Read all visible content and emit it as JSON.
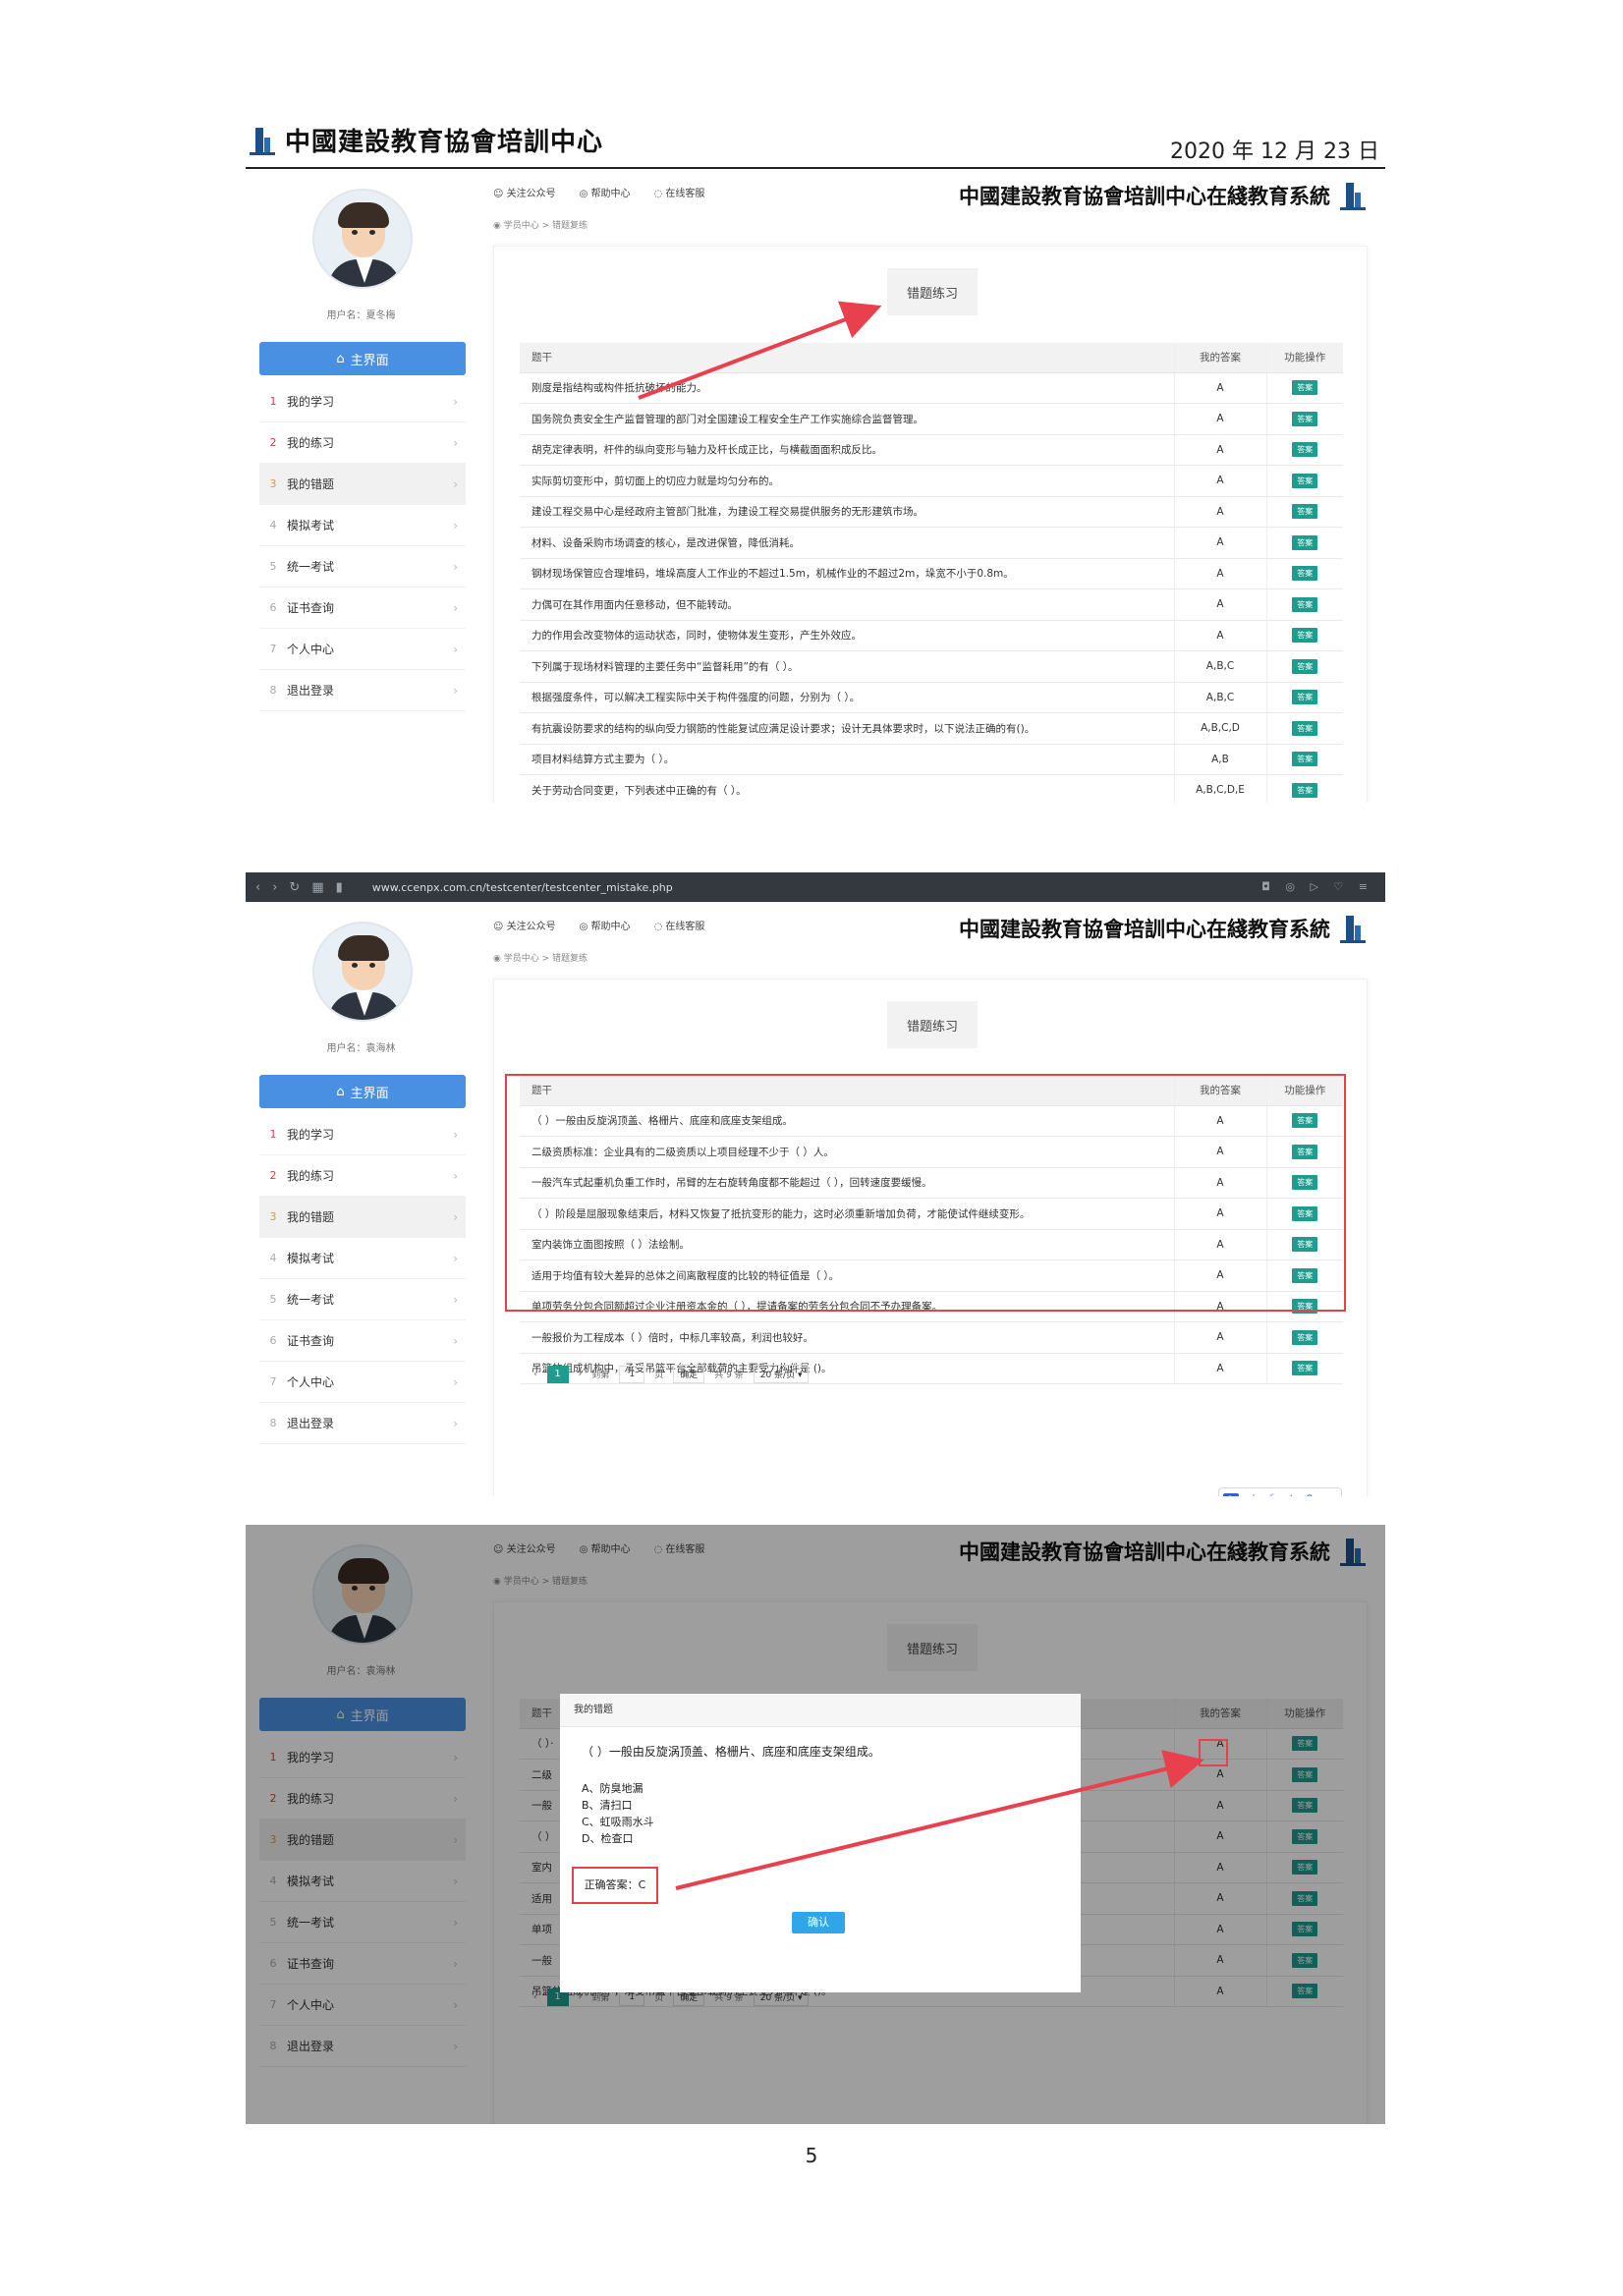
{
  "doc": {
    "org_title": "中國建設教育協會培訓中心",
    "date": "2020 年 12 月 23 日",
    "page_number": "5"
  },
  "site": {
    "brand": "中國建設教育協會培訓中心在綫教育系統",
    "top_links": [
      "关注公众号",
      "帮助中心",
      "在线客服"
    ],
    "breadcrumb": "学员中心 > 错题复练",
    "main_button": "主界面",
    "panel_title": "错题练习",
    "columns": [
      "题干",
      "我的答案",
      "功能操作"
    ],
    "answer_btn": "答案",
    "menu": [
      {
        "num": "1",
        "label": "我的学习"
      },
      {
        "num": "2",
        "label": "我的练习"
      },
      {
        "num": "3",
        "label": "我的错题"
      },
      {
        "num": "4",
        "label": "模拟考试"
      },
      {
        "num": "5",
        "label": "统一考试"
      },
      {
        "num": "6",
        "label": "证书查询"
      },
      {
        "num": "7",
        "label": "个人中心"
      },
      {
        "num": "8",
        "label": "退出登录"
      }
    ]
  },
  "shot1": {
    "username": "用户名：夏冬梅",
    "rows": [
      {
        "q": "刚度是指结构或构件抵抗破坏的能力。",
        "a": "A"
      },
      {
        "q": "国务院负责安全生产监督管理的部门对全国建设工程安全生产工作实施综合监督管理。",
        "a": "A"
      },
      {
        "q": "胡克定律表明，杆件的纵向变形与轴力及杆长成正比，与横截面面积成反比。",
        "a": "A"
      },
      {
        "q": "实际剪切变形中，剪切面上的切应力就是均匀分布的。",
        "a": "A"
      },
      {
        "q": "建设工程交易中心是经政府主管部门批准，为建设工程交易提供服务的无形建筑市场。",
        "a": "A"
      },
      {
        "q": "材料、设备采购市场调查的核心，是改进保管，降低消耗。",
        "a": "A"
      },
      {
        "q": "钢材现场保管应合理堆码，堆垛高度人工作业的不超过1.5m，机械作业的不超过2m，垛宽不小于0.8m。",
        "a": "A"
      },
      {
        "q": "力偶可在其作用面内任意移动，但不能转动。",
        "a": "A"
      },
      {
        "q": "力的作用会改变物体的运动状态，同时，使物体发生变形，产生外效应。",
        "a": "A"
      },
      {
        "q": "下列属于现场材料管理的主要任务中“监督耗用”的有（ ）。",
        "a": "A,B,C"
      },
      {
        "q": "根据强度条件，可以解决工程实际中关于构件强度的问题，分别为（ ）。",
        "a": "A,B,C"
      },
      {
        "q": "有抗震设防要求的结构的纵向受力钢筋的性能复试应满足设计要求；设计无具体要求时，以下说法正确的有()。",
        "a": "A,B,C,D"
      },
      {
        "q": "项目材料结算方式主要为（ ）。",
        "a": "A,B"
      },
      {
        "q": "关于劳动合同变更，下列表述中正确的有（ ）。",
        "a": "A,B,C,D,E"
      }
    ]
  },
  "shot2": {
    "url": "www.ccenpx.com.cn/testcenter/testcenter_mistake.php",
    "username": "用户名：袁海林",
    "rows": [
      {
        "q": "（ ）一般由反旋涡顶盖、格栅片、底座和底座支架组成。",
        "a": "A"
      },
      {
        "q": "二级资质标准：企业具有的二级资质以上项目经理不少于（ ）人。",
        "a": "A"
      },
      {
        "q": "一般汽车式起重机负重工作时，吊臂的左右旋转角度都不能超过（ ），回转速度要缓慢。",
        "a": "A"
      },
      {
        "q": "（ ）阶段是屈服现象结束后，材料又恢复了抵抗变形的能力，这时必须重新增加负荷，才能使试件继续变形。",
        "a": "A"
      },
      {
        "q": "室内装饰立面图按照（ ）法绘制。",
        "a": "A"
      },
      {
        "q": "适用于均值有较大差异的总体之间离散程度的比较的特征值是（ ）。",
        "a": "A"
      },
      {
        "q": "单项劳务分包合同额超过企业注册资本金的（ ），提请备案的劳务分包合同不予办理备案。",
        "a": "A"
      },
      {
        "q": "一般报价为工程成本（ ）倍时，中标几率较高，利润也较好。",
        "a": "A"
      },
      {
        "q": "吊篮的组成机构中，承受吊篮平台全部载荷的主要受力构件是 ()。",
        "a": "A"
      }
    ],
    "pager": {
      "page": "1",
      "goto": "到第",
      "page_input": "1",
      "page_unit": "页",
      "confirm": "确定",
      "total": "共 9 条",
      "per_page": "20 条/页"
    },
    "widget_label": "中"
  },
  "shot3": {
    "username": "用户名：袁海林",
    "row_prefixes": [
      "（ ）·",
      "二级",
      "一般",
      "（ ）",
      "室内",
      "适用",
      "单项",
      "一般",
      "吊篮的组成机构中，承受吊篮平台全部载荷的主要受力构件是 ()。"
    ],
    "answers": [
      "A",
      "A",
      "A",
      "A",
      "A",
      "A",
      "A",
      "A",
      "A"
    ],
    "modal": {
      "title": "我的错题",
      "question": "（ ）一般由反旋涡顶盖、格栅片、底座和底座支架组成。",
      "options": [
        "A、防臭地漏",
        "B、清扫口",
        "C、虹吸雨水斗",
        "D、检查口"
      ],
      "correct": "正确答案：C",
      "confirm": "确认"
    }
  },
  "colors": {
    "accent": "#4a90e2",
    "teal": "#1e9c8e",
    "highlight": "#e8414d"
  }
}
